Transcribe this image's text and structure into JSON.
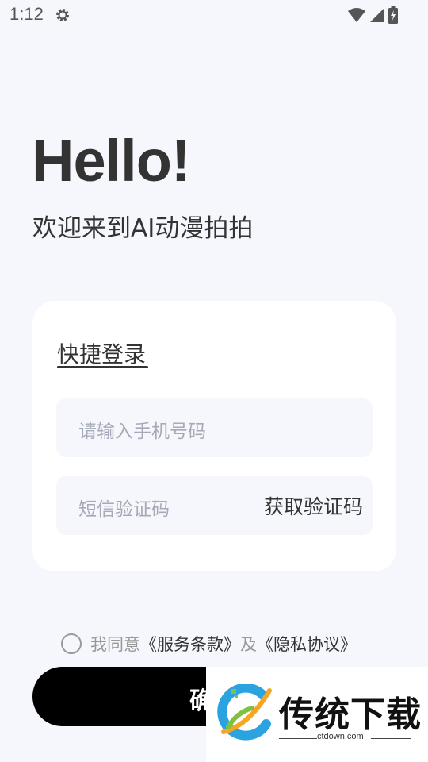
{
  "status_bar": {
    "time": "1:12",
    "icons": [
      "gear-icon",
      "wifi-icon",
      "signal-icon",
      "battery-charging-icon"
    ]
  },
  "header": {
    "greeting": "Hello!",
    "welcome": "欢迎来到AI动漫拍拍"
  },
  "login": {
    "tab_label": "快捷登录",
    "phone_placeholder": "请输入手机号码",
    "code_placeholder": "短信验证码",
    "get_code_label": "获取验证码"
  },
  "agreement": {
    "prefix": "我同意",
    "terms_link": "《服务条款》",
    "and": "及",
    "privacy_link": "《隐私协议》",
    "checked": false
  },
  "confirm": {
    "label": "确"
  },
  "watermark": {
    "brand": "传统下载",
    "url": "ctdown.com"
  },
  "colors": {
    "background": "#F6F7FC",
    "card": "#FFFFFF",
    "button": "#000000",
    "placeholder": "#A6AAB8"
  }
}
